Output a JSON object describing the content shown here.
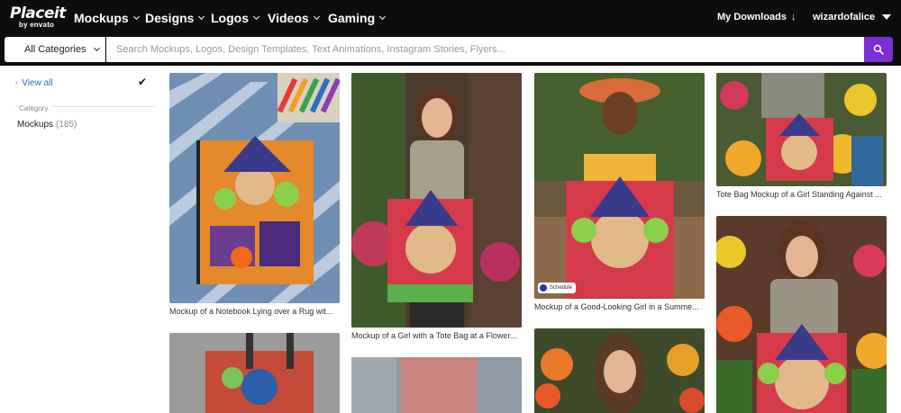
{
  "logo": {
    "main": "Placeit",
    "sub": "by envato"
  },
  "nav": {
    "items": [
      {
        "label": "Mockups"
      },
      {
        "label": "Designs"
      },
      {
        "label": "Logos"
      },
      {
        "label": "Videos"
      },
      {
        "label": "Gaming"
      }
    ],
    "my_downloads": "My Downloads",
    "username": "wizardofalice"
  },
  "search": {
    "category": "All Categories",
    "placeholder": "Search Mockups, Logos, Design Templates, Text Animations, Instagram Stories, Flyers..."
  },
  "sidebar": {
    "view_all": "View all",
    "category_heading": "Category",
    "items": [
      {
        "label": "Mockups",
        "count": "(185)"
      }
    ]
  },
  "results": [
    {
      "caption": "Mockup of a Notebook Lying over a Rug wit..."
    },
    {
      "caption": "Mockup of a Girl with a Tote Bag at a Flower..."
    },
    {
      "caption": "Mockup of a Good-Looking Girl in a Summe...",
      "badge": "Schedule"
    },
    {
      "caption": "Tote Bag Mockup of a Girl Standing Against ..."
    }
  ],
  "colors": {
    "accent": "#7b2fd0",
    "link": "#1f6fc5",
    "topbar": "#0d0d0d"
  }
}
